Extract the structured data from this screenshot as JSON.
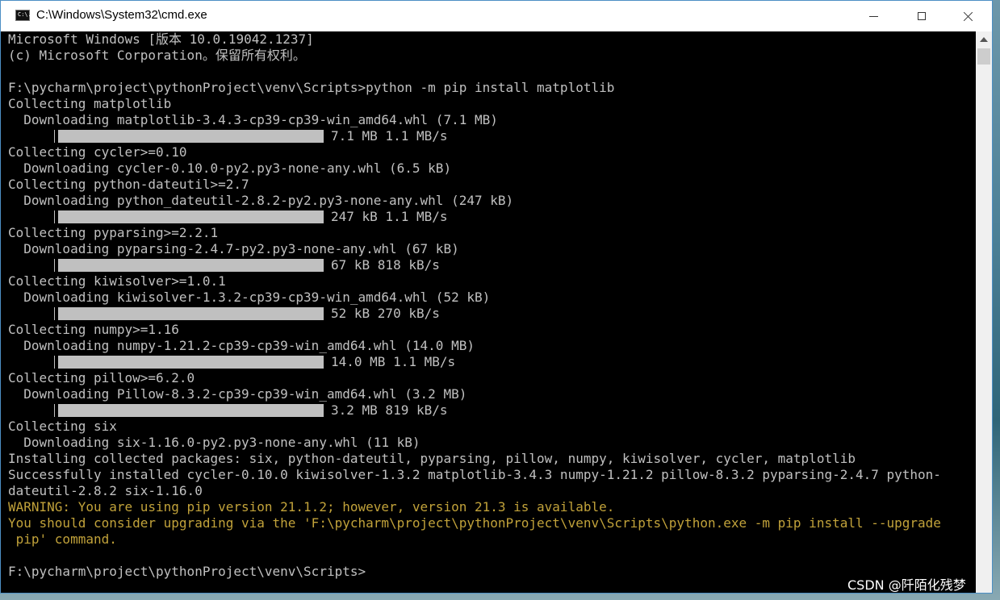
{
  "window": {
    "title": "C:\\Windows\\System32\\cmd.exe",
    "icon": "cmd-app-icon",
    "icon_text": "C:\\."
  },
  "console": {
    "text_color": "#c0c0c0",
    "warning_color": "#c1a23a",
    "background": "#000000",
    "lines": [
      {
        "type": "text",
        "text": "Microsoft Windows [版本 10.0.19042.1237]"
      },
      {
        "type": "text",
        "text": "(c) Microsoft Corporation。保留所有权利。"
      },
      {
        "type": "text",
        "text": ""
      },
      {
        "type": "text",
        "text": "F:\\pycharm\\project\\pythonProject\\venv\\Scripts>python -m pip install matplotlib"
      },
      {
        "type": "text",
        "text": "Collecting matplotlib"
      },
      {
        "type": "text",
        "text": "  Downloading matplotlib-3.4.3-cp39-cp39-win_amd64.whl (7.1 MB)"
      },
      {
        "type": "progress",
        "text": "7.1 MB 1.1 MB/s",
        "progress": 1.0
      },
      {
        "type": "text",
        "text": "Collecting cycler>=0.10"
      },
      {
        "type": "text",
        "text": "  Downloading cycler-0.10.0-py2.py3-none-any.whl (6.5 kB)"
      },
      {
        "type": "text",
        "text": "Collecting python-dateutil>=2.7"
      },
      {
        "type": "text",
        "text": "  Downloading python_dateutil-2.8.2-py2.py3-none-any.whl (247 kB)"
      },
      {
        "type": "progress",
        "text": "247 kB 1.1 MB/s",
        "progress": 1.0
      },
      {
        "type": "text",
        "text": "Collecting pyparsing>=2.2.1"
      },
      {
        "type": "text",
        "text": "  Downloading pyparsing-2.4.7-py2.py3-none-any.whl (67 kB)"
      },
      {
        "type": "progress",
        "text": "67 kB 818 kB/s",
        "progress": 1.0
      },
      {
        "type": "text",
        "text": "Collecting kiwisolver>=1.0.1"
      },
      {
        "type": "text",
        "text": "  Downloading kiwisolver-1.3.2-cp39-cp39-win_amd64.whl (52 kB)"
      },
      {
        "type": "progress",
        "text": "52 kB 270 kB/s",
        "progress": 1.0
      },
      {
        "type": "text",
        "text": "Collecting numpy>=1.16"
      },
      {
        "type": "text",
        "text": "  Downloading numpy-1.21.2-cp39-cp39-win_amd64.whl (14.0 MB)"
      },
      {
        "type": "progress",
        "text": "14.0 MB 1.1 MB/s",
        "progress": 1.0
      },
      {
        "type": "text",
        "text": "Collecting pillow>=6.2.0"
      },
      {
        "type": "text",
        "text": "  Downloading Pillow-8.3.2-cp39-cp39-win_amd64.whl (3.2 MB)"
      },
      {
        "type": "progress",
        "text": "3.2 MB 819 kB/s",
        "progress": 1.0
      },
      {
        "type": "text",
        "text": "Collecting six"
      },
      {
        "type": "text",
        "text": "  Downloading six-1.16.0-py2.py3-none-any.whl (11 kB)"
      },
      {
        "type": "text",
        "text": "Installing collected packages: six, python-dateutil, pyparsing, pillow, numpy, kiwisolver, cycler, matplotlib"
      },
      {
        "type": "text",
        "text": "Successfully installed cycler-0.10.0 kiwisolver-1.3.2 matplotlib-3.4.3 numpy-1.21.2 pillow-8.3.2 pyparsing-2.4.7 python-"
      },
      {
        "type": "text",
        "text": "dateutil-2.8.2 six-1.16.0"
      },
      {
        "type": "warn",
        "text": "WARNING: You are using pip version 21.1.2; however, version 21.3 is available."
      },
      {
        "type": "warn",
        "text": "You should consider upgrading via the 'F:\\pycharm\\project\\pythonProject\\venv\\Scripts\\python.exe -m pip install --upgrade"
      },
      {
        "type": "warn",
        "text": " pip' command."
      },
      {
        "type": "text",
        "text": ""
      },
      {
        "type": "text",
        "text": "F:\\pycharm\\project\\pythonProject\\venv\\Scripts>"
      }
    ]
  },
  "watermark": "CSDN @阡陌化残梦"
}
